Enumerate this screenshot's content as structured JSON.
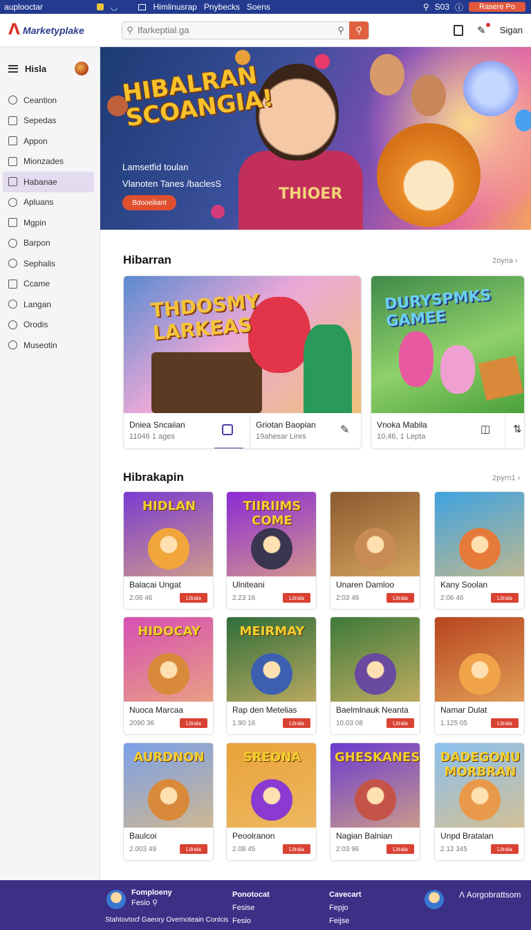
{
  "os_bar": {
    "app_name": "auplooctar",
    "items": [
      "Himlinusrap",
      "Pnybecks",
      "Soens"
    ],
    "status": "S03",
    "record_button": "Rasere Po"
  },
  "header": {
    "logo_text": "Marketyplake",
    "search_placeholder": "Ifarkeptial.ga",
    "sign_in": "Sigan"
  },
  "sidebar": {
    "title": "Hisla",
    "items": [
      {
        "label": "Ceantion",
        "icon": "tag-icon",
        "active": false
      },
      {
        "label": "Sepedas",
        "icon": "folder-icon",
        "active": false
      },
      {
        "label": "Appon",
        "icon": "app-icon",
        "active": false
      },
      {
        "label": "Mionzades",
        "icon": "bookmark-icon",
        "active": false
      },
      {
        "label": "Habanae",
        "icon": "bookmark-icon",
        "active": true
      },
      {
        "label": "Apluans",
        "icon": "leaf-icon",
        "active": false
      },
      {
        "label": "Mgpin",
        "icon": "grid-icon",
        "active": false
      },
      {
        "label": "Barpon",
        "icon": "tag-icon",
        "active": false
      },
      {
        "label": "Sephalis",
        "icon": "search-icon",
        "active": false
      },
      {
        "label": "Ccame",
        "icon": "list-icon",
        "active": false
      },
      {
        "label": "Langan",
        "icon": "chat-icon",
        "active": false
      },
      {
        "label": "Orodis",
        "icon": "user-icon",
        "active": false
      },
      {
        "label": "Museotin",
        "icon": "info-icon",
        "active": false
      }
    ]
  },
  "hero": {
    "title": "HIBALRAN SCOANGIA!",
    "subtitle_1": "Lamsetfid toulan",
    "subtitle_2": "Vlanoten Tanes /baclesS",
    "cta": "Bdooeiliant",
    "shirt_text": "THIOER"
  },
  "section_1": {
    "title": "Hibarran",
    "more": "2oyria",
    "featured": [
      {
        "art_title": "THDOSMY LARKEAS",
        "items": [
          {
            "name": "Dniea Sncaiian",
            "sub": "11046 1 ages"
          },
          {
            "name": "Griotan Baopian",
            "sub": "19ahesar Lires"
          }
        ]
      },
      {
        "art_title": "DURYSPMKS GAMEE",
        "items": [
          {
            "name": "Vnoka Mabila",
            "sub": "10,46, 1 Lepta"
          }
        ]
      }
    ]
  },
  "section_2": {
    "title": "Hibrakapin",
    "more": "2pyrn1",
    "cards": [
      {
        "art": "HIDLAN",
        "name": "Balacai Ungat",
        "count": "2:06 46",
        "tag": "Litrala",
        "bg": "#7a3bd0",
        "blob": "#f0a63a"
      },
      {
        "art": "TIIRIIMS COME",
        "name": "Ulniteani",
        "count": "2.23 16",
        "tag": "Litrala",
        "bg": "#8a2ad6",
        "blob": "#3a3550"
      },
      {
        "art": "",
        "name": "Unaren Damloo",
        "count": "2:03 46",
        "tag": "Litrala",
        "bg": "#8b5a2f",
        "blob": "#c98b55"
      },
      {
        "art": "",
        "name": "Kany Soolan",
        "count": "2:06 46",
        "tag": "Litrala",
        "bg": "#3fa3e0",
        "blob": "#e57a3a"
      },
      {
        "art": "HIDOCAY",
        "name": "Nuoca Marcaa",
        "count": "2090 36",
        "tag": "Litrala",
        "bg": "#d64fb4",
        "blob": "#d88a3a"
      },
      {
        "art": "MEIRMAY",
        "name": "Rap den Metelias",
        "count": "1.90 16",
        "tag": "Litrala",
        "bg": "#2f6e3a",
        "blob": "#3c5fb0"
      },
      {
        "art": "",
        "name": "Baelmlnauk Neanta",
        "count": "10.03 08",
        "tag": "Litrala",
        "bg": "#3e7a3a",
        "blob": "#6a4aa0"
      },
      {
        "art": "",
        "name": "Namar Dulat",
        "count": "1.125 05",
        "tag": "Litrala",
        "bg": "#b8451e",
        "blob": "#f1a34a"
      },
      {
        "art": "AURDNON",
        "name": "Baulcoi",
        "count": "2.003 49",
        "tag": "Litrala",
        "bg": "#7aa0e8",
        "blob": "#d88a3a"
      },
      {
        "art": "SREONA",
        "name": "Peoolranon",
        "count": "2.08 45",
        "tag": "Litrala",
        "bg": "#e8a23a",
        "blob": "#8a3ad0"
      },
      {
        "art": "GHESKANES",
        "name": "Nagian Balnian",
        "count": "2:03 96",
        "tag": "Litrala",
        "bg": "#6a3ad0",
        "blob": "#c4544a"
      },
      {
        "art": "DADEGONU MORBRAN",
        "name": "Unpd Bratalan",
        "count": "2.12 345",
        "tag": "Litrala",
        "bg": "#8ac0f0",
        "blob": "#e89a4a"
      }
    ]
  },
  "footer": {
    "col1_title": "Fomploeny",
    "col1_line": "Fesio",
    "col1_bottom": "Stahtovtocf Gaeory Overnoteain Conlcis",
    "col2_title": "Ponotocat",
    "col2_items": [
      "Fesise",
      "Fesio"
    ],
    "col3_title": "Cavecart",
    "col3_items": [
      "Fepjo",
      "Feijse"
    ],
    "brand": "Aorgobrattsom"
  },
  "colors": {
    "brand_blue": "#233a8f",
    "accent_orange": "#e0613f",
    "footer_purple": "#3b2f86",
    "active_sidebar": "#e3dcf0",
    "tag_red": "#d94233"
  }
}
